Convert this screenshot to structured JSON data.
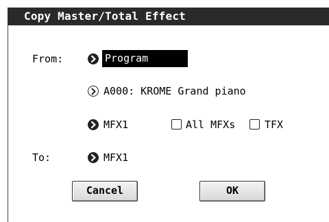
{
  "dialog": {
    "title": "Copy Master/Total Effect"
  },
  "from": {
    "label": "From:",
    "source_value": "Program",
    "program_value": "A000: KROME Grand piano",
    "effect_value": "MFX1",
    "all_mfxs_label": "All MFXs",
    "tfx_label": "TFX",
    "all_mfxs_checked": false,
    "tfx_checked": false
  },
  "to": {
    "label": "To:",
    "effect_value": "MFX1"
  },
  "buttons": {
    "cancel_label": "Cancel",
    "ok_label": "OK"
  },
  "icons": {
    "popup_arrow": "chevron-right-icon"
  }
}
